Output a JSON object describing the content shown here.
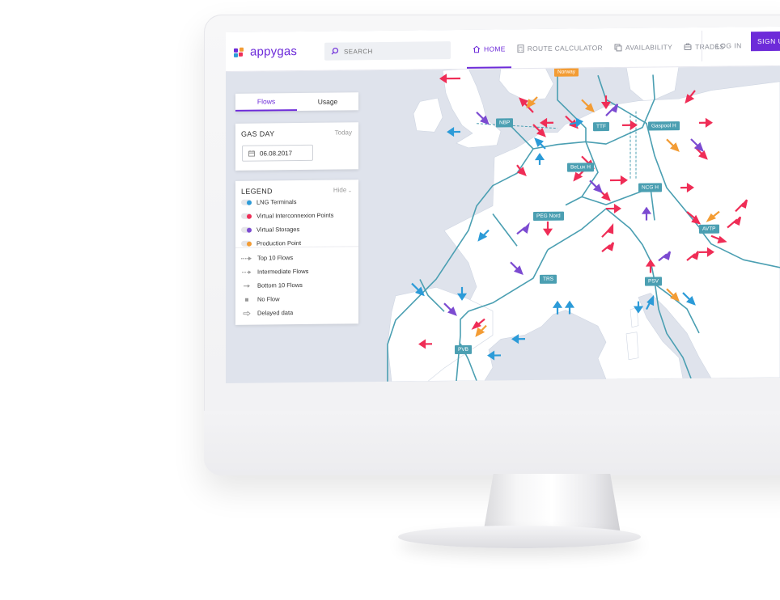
{
  "brand": {
    "name": "appygas",
    "accent": "#6d2bd9"
  },
  "search": {
    "placeholder": "SEARCH",
    "icon": "search-icon"
  },
  "nav": {
    "items": [
      {
        "label": "HOME",
        "icon": "home-icon",
        "active": true
      },
      {
        "label": "ROUTE CALCULATOR",
        "icon": "calculator-icon"
      },
      {
        "label": "AVAILABILITY",
        "icon": "availability-icon"
      },
      {
        "label": "TRADES",
        "icon": "trades-icon"
      }
    ],
    "login": "LOG IN",
    "signup": "SIGN UP"
  },
  "side": {
    "tabs": [
      "Flows",
      "Usage"
    ],
    "gas_day": {
      "title": "GAS DAY",
      "today": "Today",
      "date": "06.08.2017"
    },
    "legend": {
      "title": "LEGEND",
      "hide": "Hide",
      "points": [
        {
          "label": "LNG Terminals",
          "color": "#2c9bd8"
        },
        {
          "label": "Virtual Interconnexion Points",
          "color": "#ef2d56"
        },
        {
          "label": "Virtual Storages",
          "color": "#7c4bd1"
        },
        {
          "label": "Production Point",
          "color": "#f39c34"
        }
      ],
      "flows": [
        "Top 10 Flows",
        "Intermediate Flows",
        "Bottom 10 Flows",
        "No Flow",
        "Delayed data"
      ]
    }
  },
  "map": {
    "hubs": [
      "Norway",
      "NBP",
      "TTF",
      "Gaspool H",
      "BeLux H",
      "NCG H",
      "PEG Nord",
      "AVTP",
      "TRS",
      "PSV",
      "PVB"
    ],
    "colors": {
      "land": "#ffffff",
      "sea": "#dfe3ec",
      "pipeline": "#4b9fb2",
      "hub": "#4b9fb2",
      "norway": "#f39c34"
    }
  }
}
